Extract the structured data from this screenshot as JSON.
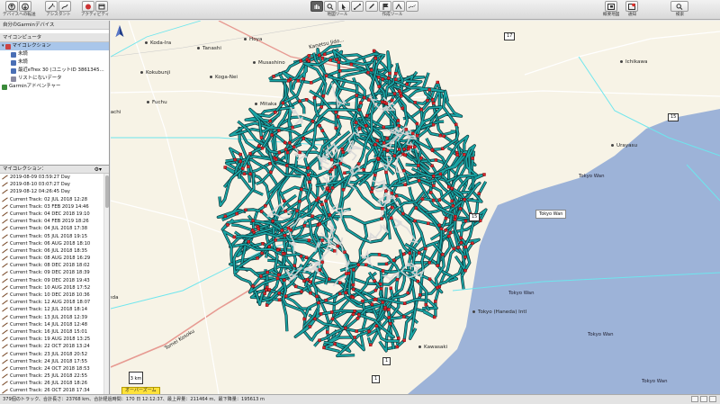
{
  "toolbar": {
    "groups_left": [
      {
        "label": "デバイスへの転送",
        "icons": [
          "upload-icon",
          "download-icon"
        ]
      },
      {
        "label": "アシスタント",
        "icons": [
          "wizard-icon",
          "route-icon"
        ]
      },
      {
        "label": "アクティビティ",
        "icons": [
          "activity-icon",
          "calendar-icon"
        ]
      }
    ],
    "map_tools": {
      "label": "地図ツール",
      "icons": [
        "hand-icon",
        "zoom-icon",
        "pointer-icon",
        "measure-icon"
      ]
    },
    "create_tools": {
      "label": "作成ツール",
      "icons": [
        "pencil-icon",
        "flag-icon",
        "route-tool-icon",
        "track-tool-icon"
      ]
    },
    "right": [
      {
        "label": "概要地図",
        "icon": "overview-map-icon"
      },
      {
        "label": "通知",
        "icon": "notification-icon"
      },
      {
        "label": "検索",
        "icon": "search-icon"
      }
    ]
  },
  "devices": {
    "header": "自分のGarminデバイス"
  },
  "library": {
    "header": "マイコンピュータ",
    "items": [
      {
        "label": "マイコレクション",
        "selected": true,
        "indent": 0,
        "icon": "collection-icon"
      },
      {
        "label": "未読",
        "indent": 1,
        "icon": "unread-folder-icon"
      },
      {
        "label": "未読",
        "indent": 1,
        "icon": "unread-folder-icon"
      },
      {
        "label": "最近eTrex 30 (ユニットID 3861345...",
        "indent": 1,
        "icon": "device-folder-icon"
      },
      {
        "label": "リストにないデータ",
        "indent": 1,
        "icon": "list-folder-icon"
      },
      {
        "label": "Garminアドベンチャー",
        "indent": 0,
        "icon": "adventure-icon"
      }
    ]
  },
  "collection_panel": {
    "header": "マイコレクション：",
    "tracks": [
      "2019-08-09 03:59:27 Day",
      "2019-08-10 03:07:27 Day",
      "2019-08-12 04:26:45 Day",
      "Current Track: 02 JUL 2018 12:28",
      "Current Track: 03 FEB 2019 14:46",
      "Current Track: 04 DEC 2018 19:10",
      "Current Track: 04 FEB 2019 18:26",
      "Current Track: 04 JUL 2018 17:38",
      "Current Track: 05 JUL 2018 19:15",
      "Current Track: 06 AUG 2018 18:10",
      "Current Track: 06 JUL 2018 18:35",
      "Current Track: 08 AUG 2018 16:29",
      "Current Track: 08 DEC 2018 18:02",
      "Current Track: 09 DEC 2018 18:39",
      "Current Track: 09 DEC 2018 19:43",
      "Current Track: 10 AUG 2018 17:52",
      "Current Track: 10 DEC 2018 10:36",
      "Current Track: 12 AUG 2018 18:07",
      "Current Track: 12 JUL 2018 18:14",
      "Current Track: 13 JUL 2018 12:39",
      "Current Track: 14 JUL 2018 12:48",
      "Current Track: 16 JUL 2018 15:01",
      "Current Track: 19 AUG 2018 13:25",
      "Current Track: 22 OCT 2018 13:24",
      "Current Track: 23 JUL 2018 20:52",
      "Current Track: 24 JUL 2018 17:55",
      "Current Track: 24 OCT 2018 18:53",
      "Current Track: 25 JUL 2018 22:55",
      "Current Track: 26 JUL 2018 18:26",
      "Current Track: 26 OCT 2018 17:34",
      "Current Track: 27 JUL 2018 18:42"
    ]
  },
  "map": {
    "places": [
      {
        "name": "Koda-Ira"
      },
      {
        "name": "Tanashi"
      },
      {
        "name": "Hoya"
      },
      {
        "name": "Kokubunji"
      },
      {
        "name": "Koga-Nei"
      },
      {
        "name": "Musashino"
      },
      {
        "name": "Fuchu"
      },
      {
        "name": "Mitaka"
      },
      {
        "name": "Ichikawa"
      },
      {
        "name": "Urayasu"
      },
      {
        "name": "Tokyo Wan"
      },
      {
        "name": "Tokyo Wan"
      },
      {
        "name": "Kawasaki"
      },
      {
        "name": "Tokyo (Haneda) Intl"
      },
      {
        "name": "Tokyo Wan"
      },
      {
        "name": "Tokyo Wan"
      }
    ],
    "side_label": "itachi",
    "side_label2": "nda",
    "roads": [
      "Kanetsu Jido...",
      "Tomei Kosoku"
    ],
    "shields": [
      "17",
      "15",
      "15",
      "1",
      "1",
      "16"
    ],
    "callout": "Tokyo Wan",
    "scale": "3 km",
    "overzoom": "オーバーズーム",
    "colors": {
      "water": "#9db3d8",
      "land": "#f7f3e6",
      "track": "#1aa5a5",
      "track_outline": "#0c2f33",
      "waypoint": "#d8262c",
      "road": "#ffffff",
      "highway": "#e79a92",
      "rail": "#6ee6ee"
    }
  },
  "statusbar": {
    "text": "379個のトラック、合計長さ：23768 km、合計経過時間：170 日 12:12:37、最上昇量：211464 m、最下降量：195613 m"
  }
}
